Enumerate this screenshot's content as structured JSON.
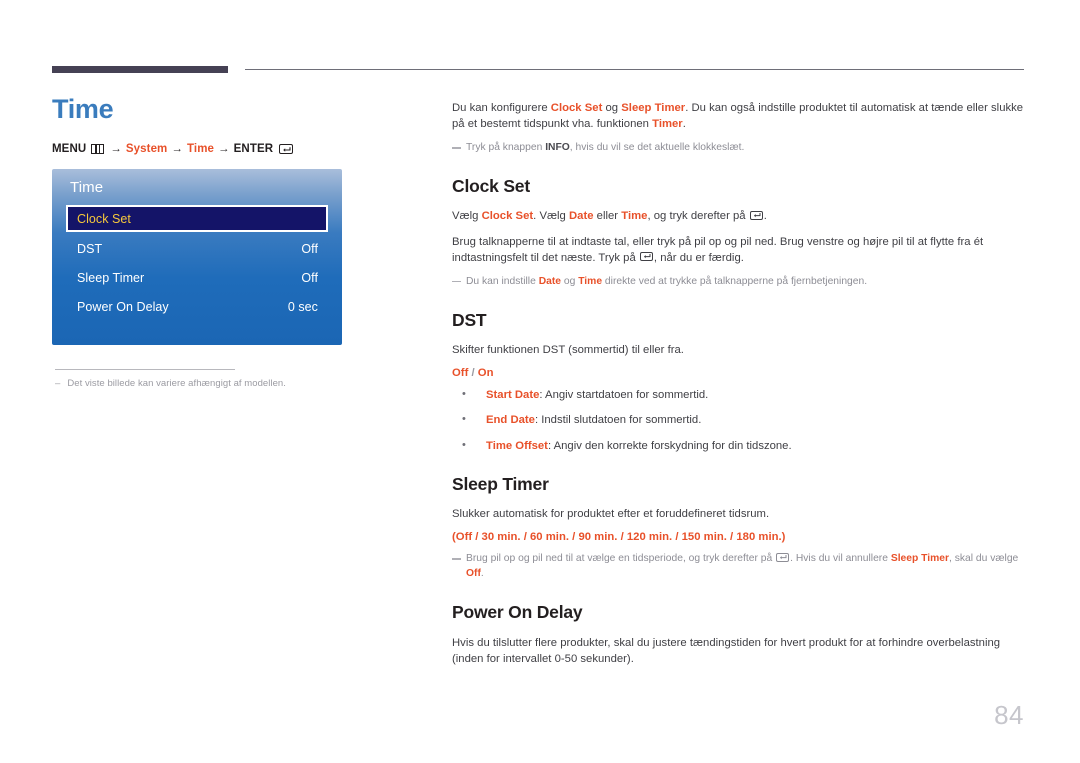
{
  "page": {
    "title": "Time",
    "number": "84"
  },
  "menu_path": {
    "menu_label": "MENU",
    "menu_icon": "menu-grid-icon",
    "arrow": "→",
    "step1": "System",
    "step2": "Time",
    "enter_label": "ENTER",
    "enter_icon": "enter-key-icon"
  },
  "osd": {
    "title": "Time",
    "rows": [
      {
        "label": "Clock Set",
        "value": "",
        "selected": true
      },
      {
        "label": "DST",
        "value": "Off",
        "selected": false
      },
      {
        "label": "Sleep Timer",
        "value": "Off",
        "selected": false
      },
      {
        "label": "Power On Delay",
        "value": "0 sec",
        "selected": false
      }
    ]
  },
  "left_note": {
    "dash": "–",
    "text": "Det viste billede kan variere afhængigt af modellen."
  },
  "intro": {
    "p1_a": "Du kan konfigurere ",
    "p1_b1": "Clock Set",
    "p1_b": " og ",
    "p1_b2": "Sleep Timer",
    "p1_c": ". Du kan også indstille produktet til automatisk at tænde eller slukke på et bestemt tidspunkt vha. funktionen ",
    "p1_b3": "Timer",
    "p1_d": ".",
    "note_a": "Tryk på knappen ",
    "note_b": "INFO",
    "note_c": ", hvis du vil se det aktuelle klokkeslæt."
  },
  "sections": [
    {
      "heading": "Clock Set",
      "p1_a": "Vælg ",
      "p1_b1": "Clock Set",
      "p1_b": ". Vælg ",
      "p1_b2": "Date",
      "p1_c": " eller ",
      "p1_b3": "Time",
      "p1_d": ", og tryk derefter på ",
      "p1_e": ".",
      "p2_a": "Brug talknapperne til at indtaste tal, eller tryk på pil op og pil ned. Brug venstre og højre pil til at flytte fra ét indtastningsfelt til det næste. Tryk på ",
      "p2_b": ", når du er færdig.",
      "note_a": "Du kan indstille ",
      "note_b1": "Date",
      "note_b": " og ",
      "note_b2": "Time",
      "note_c": " direkte ved at trykke på talknapperne på fjernbetjeningen."
    },
    {
      "heading": "DST",
      "p1": "Skifter funktionen DST (sommertid) til eller fra.",
      "opts_on": "Off",
      "opts_sep": " / ",
      "opts_off": "On",
      "bullets": [
        {
          "term": "Start Date",
          "desc": ": Angiv startdatoen for sommertid."
        },
        {
          "term": "End Date",
          "desc": ": Indstil slutdatoen for sommertid."
        },
        {
          "term": "Time Offset",
          "desc": ": Angiv den korrekte forskydning for din tidszone."
        }
      ]
    },
    {
      "heading": "Sleep Timer",
      "p1": "Slukker automatisk for produktet efter et foruddefineret tidsrum.",
      "opts": "(Off / 30 min. / 60 min. / 90 min. / 120 min. / 150 min. / 180 min.)",
      "note_a": "Brug pil op og pil ned til at vælge en tidsperiode, og tryk derefter på ",
      "note_b": ". Hvis du vil annullere ",
      "note_b1": "Sleep Timer",
      "note_c": ", skal du vælge ",
      "note_b2": "Off",
      "note_d": "."
    },
    {
      "heading": "Power On Delay",
      "p1": "Hvis du tilslutter flere produkter, skal du justere tændingstiden for hvert produkt for at forhindre overbelastning (inden for intervallet 0-50 sekunder)."
    }
  ],
  "colors": {
    "accent_orange": "#e8512a",
    "title_blue": "#3a7cbd",
    "osd_blue": "#1f6cba",
    "osd_selected_bg": "#141468",
    "osd_selected_text": "#f6c83b",
    "rule_dark": "#454154"
  }
}
